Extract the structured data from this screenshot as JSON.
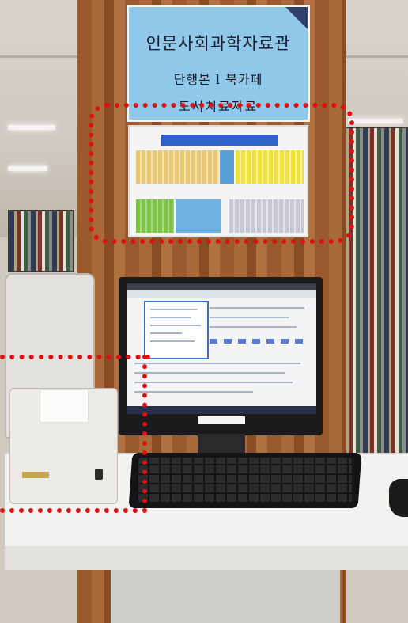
{
  "sign": {
    "title": "인문사회과학자료관",
    "line1": "단행본 l 북카페",
    "line2": "도서치료자료"
  },
  "colors": {
    "sign_blue": "#8fc8e8",
    "highlight_red": "#e01010",
    "wood": "#9a5a2e"
  }
}
